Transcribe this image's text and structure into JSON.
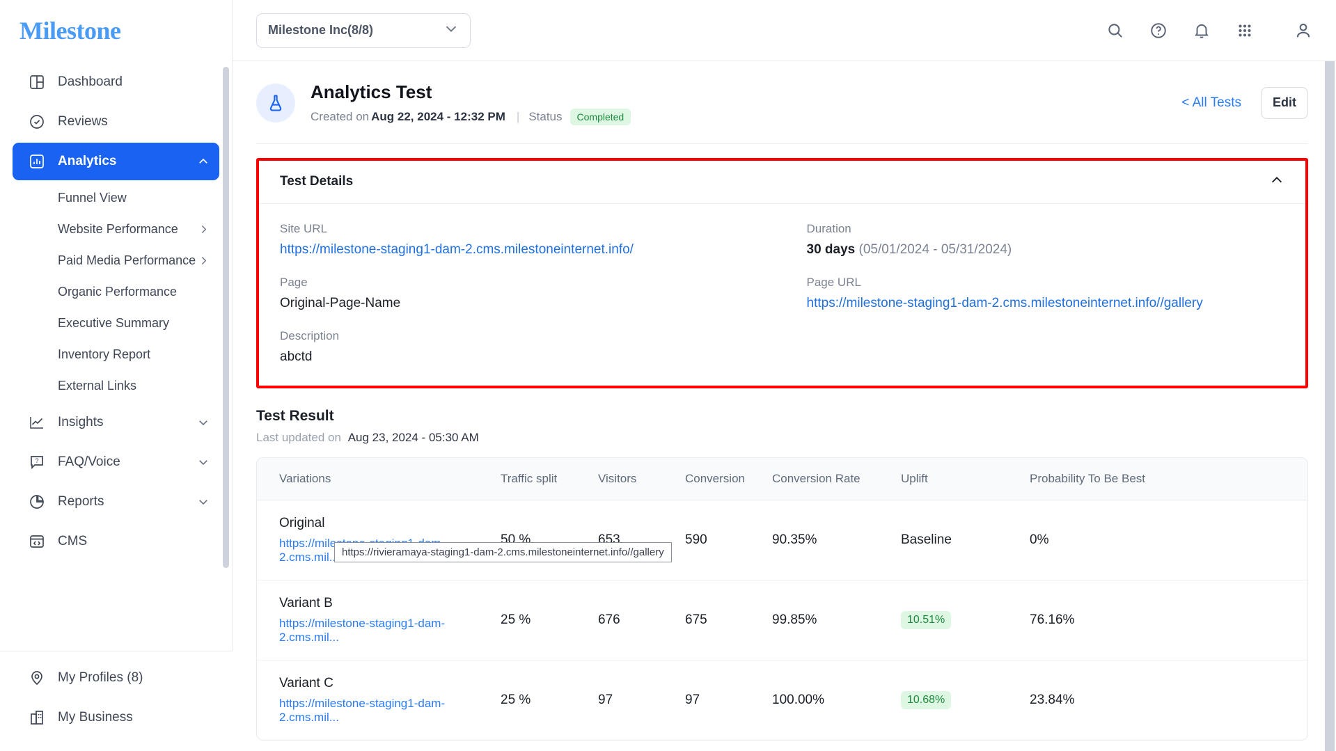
{
  "brand": {
    "name": "Milestone"
  },
  "sidebar": {
    "items": [
      {
        "label": "Dashboard",
        "icon": "dashboard-icon",
        "type": "item"
      },
      {
        "label": "Reviews",
        "icon": "check-badge-icon",
        "type": "item"
      },
      {
        "label": "Analytics",
        "icon": "bar-chart-icon",
        "type": "item",
        "active": true,
        "chevron": "chevron-up-icon"
      },
      {
        "label": "Funnel View",
        "type": "sub"
      },
      {
        "label": "Website Performance",
        "type": "sub",
        "chevron": "chevron-right-icon"
      },
      {
        "label": "Paid Media Performance",
        "type": "sub",
        "chevron": "chevron-right-icon"
      },
      {
        "label": "Organic Performance",
        "type": "sub"
      },
      {
        "label": "Executive Summary",
        "type": "sub"
      },
      {
        "label": "Inventory Report",
        "type": "sub"
      },
      {
        "label": "External Links",
        "type": "sub"
      },
      {
        "label": "Insights",
        "icon": "line-chart-icon",
        "type": "item",
        "chevron": "chevron-down-icon"
      },
      {
        "label": "FAQ/Voice",
        "icon": "question-bubble-icon",
        "type": "item",
        "chevron": "chevron-down-icon"
      },
      {
        "label": "Reports",
        "icon": "pie-chart-icon",
        "type": "item",
        "chevron": "chevron-down-icon"
      },
      {
        "label": "CMS",
        "icon": "code-window-icon",
        "type": "item"
      }
    ],
    "bottom_items": [
      {
        "label": "My Profiles (8)",
        "icon": "location-pin-icon"
      },
      {
        "label": "My Business",
        "icon": "building-icon"
      }
    ]
  },
  "topbar": {
    "org_selector": "Milestone Inc(8/8)",
    "icons": [
      "search-icon",
      "help-circle-icon",
      "bell-icon",
      "grid-apps-icon",
      "user-avatar-icon"
    ]
  },
  "page": {
    "icon": "flask-icon",
    "title": "Analytics Test",
    "created_prefix": "Created on",
    "created_date": "Aug 22, 2024 - 12:32 PM",
    "status_label": "Status",
    "status_value": "Completed",
    "all_tests_link": "< All Tests",
    "edit_button": "Edit"
  },
  "test_details": {
    "title": "Test Details",
    "collapse_icon": "chevron-up-icon",
    "site_url_label": "Site URL",
    "site_url_value": "https://milestone-staging1-dam-2.cms.milestoneinternet.info/",
    "page_label": "Page",
    "page_value": "Original-Page-Name",
    "description_label": "Description",
    "description_value": "abctd",
    "duration_label": "Duration",
    "duration_value": "30 days",
    "duration_range": "(05/01/2024 - 05/31/2024)",
    "page_url_label": "Page URL",
    "page_url_value": "https://milestone-staging1-dam-2.cms.milestoneinternet.info//gallery"
  },
  "test_result": {
    "title": "Test Result",
    "last_updated_label": "Last updated on",
    "last_updated_value": "Aug 23, 2024 - 05:30 AM",
    "columns": [
      "Variations",
      "Traffic split",
      "Visitors",
      "Conversion",
      "Conversion Rate",
      "Uplift",
      "Probability To Be Best"
    ],
    "rows": [
      {
        "name": "Original",
        "url": "https://milestone-staging1-dam-2.cms.mil...",
        "traffic_split": "50 %",
        "visitors": "653",
        "conversion": "590",
        "conversion_rate": "90.35%",
        "uplift": "Baseline",
        "uplift_pill": false,
        "probability": "0%"
      },
      {
        "name": "Variant B",
        "url": "https://milestone-staging1-dam-2.cms.mil...",
        "traffic_split": "25 %",
        "visitors": "676",
        "conversion": "675",
        "conversion_rate": "99.85%",
        "uplift": "10.51%",
        "uplift_pill": true,
        "probability": "76.16%"
      },
      {
        "name": "Variant C",
        "url": "https://milestone-staging1-dam-2.cms.mil...",
        "traffic_split": "25 %",
        "visitors": "97",
        "conversion": "97",
        "conversion_rate": "100.00%",
        "uplift": "10.68%",
        "uplift_pill": true,
        "probability": "23.84%"
      }
    ]
  },
  "tooltip": {
    "text": "https://rivieramaya-staging1-dam-2.cms.milestoneinternet.info//gallery"
  },
  "colors": {
    "brand_blue": "#4a9bf5",
    "active_nav": "#1a62f2",
    "link_blue": "#2b7bf3",
    "success_bg": "#ddf7e3",
    "success_text": "#1d8a3e",
    "highlight_red": "#ff0000"
  }
}
